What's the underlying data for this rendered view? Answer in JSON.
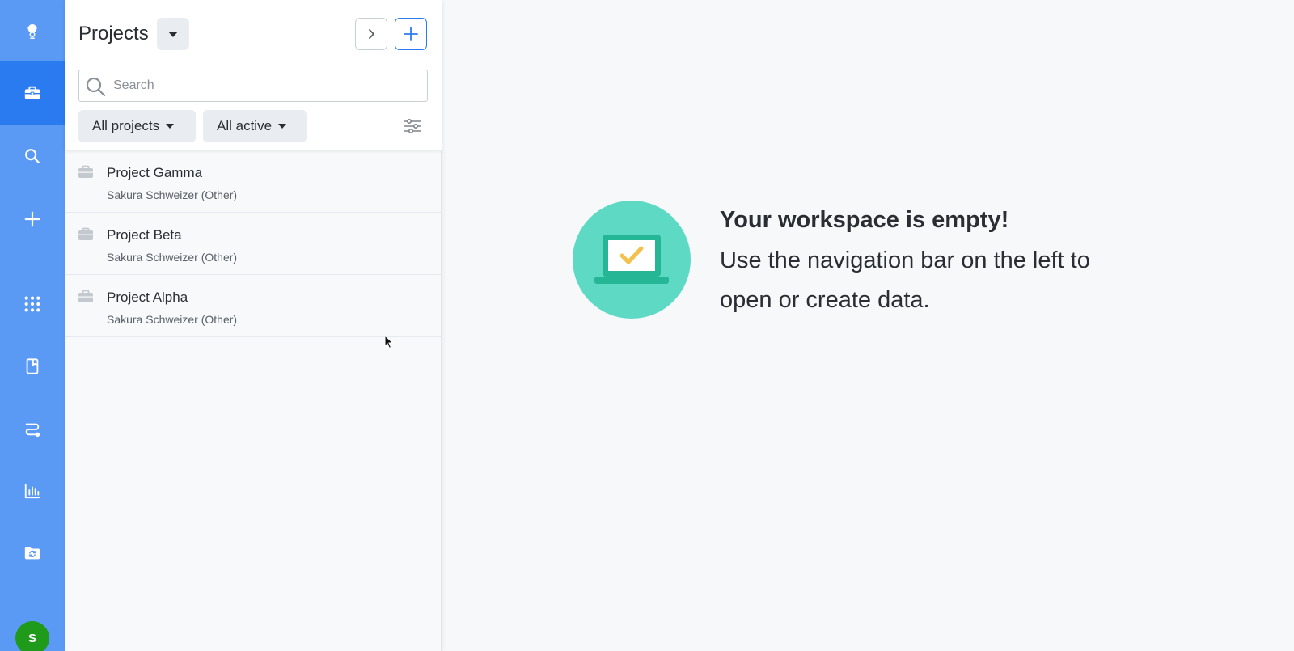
{
  "rail": {
    "items": [
      {
        "icon": "mascot-logo-icon"
      },
      {
        "icon": "briefcase-icon",
        "active": true
      },
      {
        "icon": "search-icon"
      },
      {
        "icon": "plus-icon"
      },
      {
        "icon": "apps-grid-icon"
      },
      {
        "icon": "notebook-icon"
      },
      {
        "icon": "workflow-icon"
      },
      {
        "icon": "bar-chart-icon"
      },
      {
        "icon": "folder-sync-icon"
      }
    ],
    "avatar_initial": "S",
    "avatar_color": "#1f9a1a",
    "color": "#5a9af4",
    "active_color": "#2b7bf0"
  },
  "panel": {
    "title": "Projects",
    "search_placeholder": "Search",
    "filters": {
      "scope": "All projects",
      "status": "All active"
    },
    "projects": [
      {
        "name": "Project Gamma",
        "owner": "Sakura Schweizer (Other)"
      },
      {
        "name": "Project Beta",
        "owner": "Sakura Schweizer (Other)"
      },
      {
        "name": "Project Alpha",
        "owner": "Sakura Schweizer (Other)"
      }
    ]
  },
  "empty_state": {
    "title": "Your workspace is empty!",
    "line1": "Use the navigation bar on the left to",
    "line2": "open or create data.",
    "illustration": "laptop-check-icon",
    "color": "#5edac4"
  }
}
